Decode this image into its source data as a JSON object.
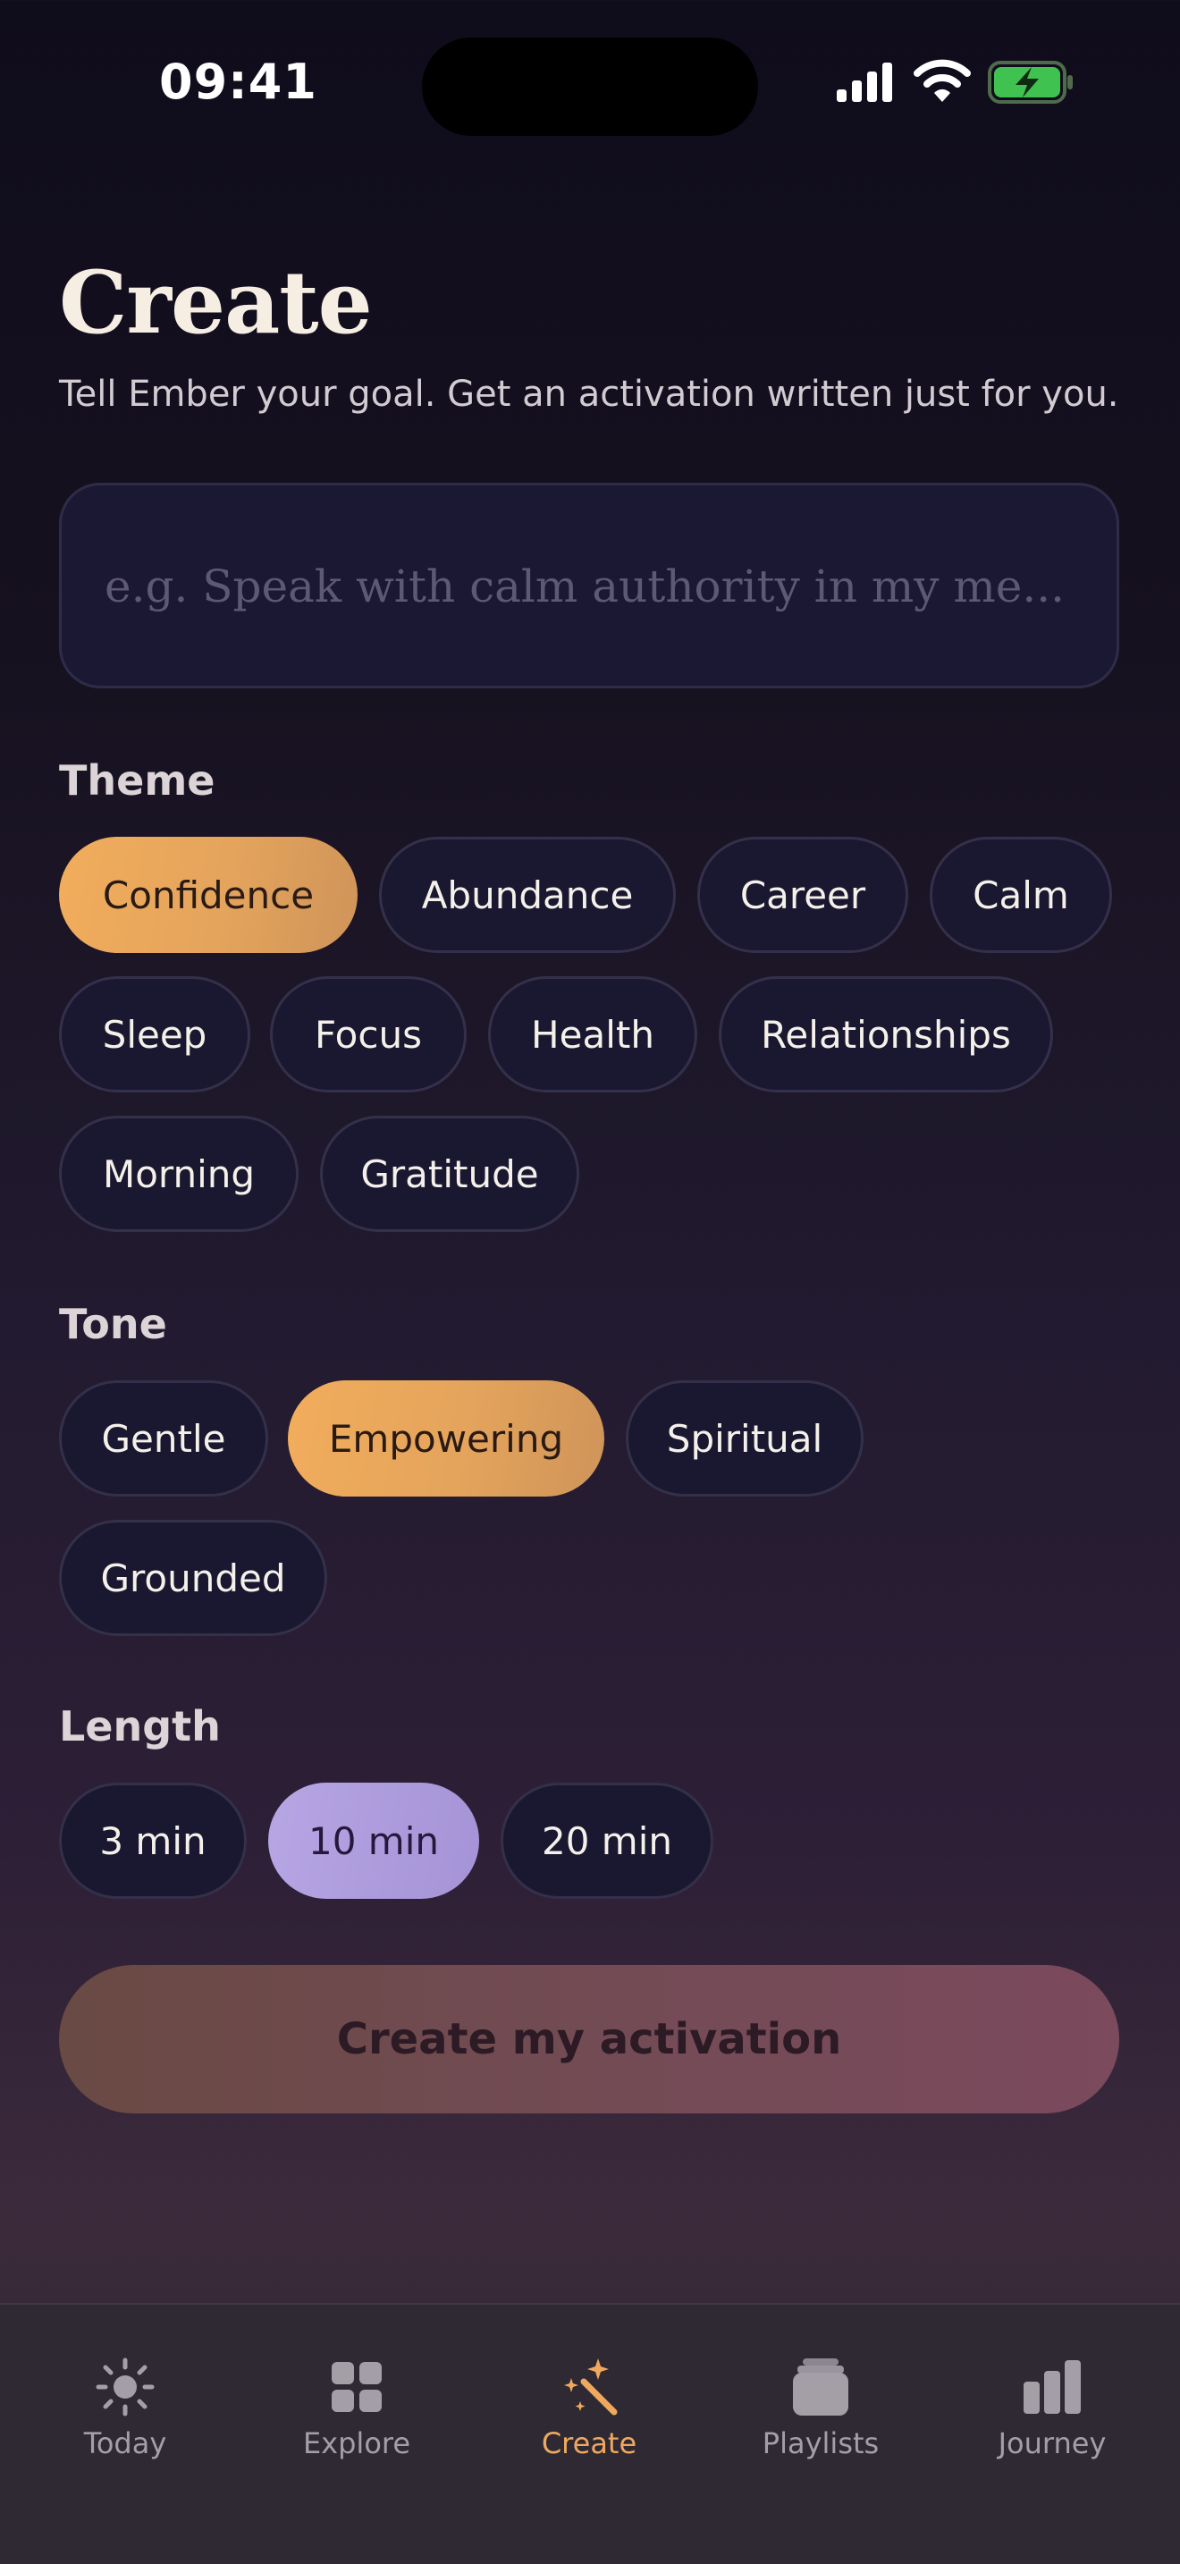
{
  "status_bar": {
    "time": "09:41"
  },
  "header": {
    "title": "Create",
    "subtitle": "Tell Ember your goal. Get an activation written just for you."
  },
  "goal": {
    "value": "",
    "placeholder": "e.g. Speak with calm authority in my me..."
  },
  "theme": {
    "label": "Theme",
    "selected": "Confidence",
    "options": [
      "Confidence",
      "Abundance",
      "Career",
      "Calm",
      "Sleep",
      "Focus",
      "Health",
      "Relationships",
      "Morning",
      "Gratitude"
    ]
  },
  "tone": {
    "label": "Tone",
    "selected": "Empowering",
    "options": [
      "Gentle",
      "Empowering",
      "Spiritual",
      "Grounded"
    ]
  },
  "length": {
    "label": "Length",
    "selected": "10 min",
    "options": [
      "3 min",
      "10 min",
      "20 min"
    ]
  },
  "cta": {
    "label": "Create my activation"
  },
  "tabs": [
    {
      "label": "Today",
      "icon": "sun-icon",
      "active": false
    },
    {
      "label": "Explore",
      "icon": "grid-icon",
      "active": false
    },
    {
      "label": "Create",
      "icon": "magic-wand-icon",
      "active": true
    },
    {
      "label": "Playlists",
      "icon": "stack-icon",
      "active": false
    },
    {
      "label": "Journey",
      "icon": "bar-chart-icon",
      "active": false
    }
  ],
  "colors": {
    "accent": "#eea95f",
    "lavender": "#ac9bdc",
    "chip_bg": "#1a1830"
  }
}
